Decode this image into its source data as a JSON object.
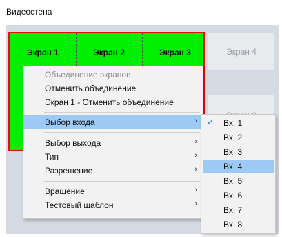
{
  "title": "Видеостена",
  "screens": {
    "s1": "Экран 1",
    "s2": "Экран 2",
    "s3": "Экран 3",
    "s4": "Экран 4",
    "s8": "Экран 8"
  },
  "colors": {
    "merged_fill": "#00ee00",
    "merged_border": "#e01010",
    "highlight": "#9ccaf5"
  },
  "menu": {
    "items": [
      {
        "label": "Объединение экранов",
        "disabled": true
      },
      {
        "label": "Отменить объединение"
      },
      {
        "label": "Экран 1 - Отменить объединение"
      },
      {
        "label": "Выбор входа",
        "submenu": true,
        "highlighted": true
      },
      {
        "label": "Выбор выхода",
        "submenu": true
      },
      {
        "label": "Тип",
        "submenu": true
      },
      {
        "label": "Разрешение",
        "submenu": true
      },
      {
        "label": "Вращение",
        "submenu": true
      },
      {
        "label": "Тестовый шаблон",
        "submenu": true
      }
    ],
    "arrow": "›"
  },
  "submenu": {
    "check": "✓",
    "items": [
      {
        "label": "Вх. 1",
        "checked": true
      },
      {
        "label": "Вх. 2"
      },
      {
        "label": "Вх. 3"
      },
      {
        "label": "Вх. 4",
        "highlighted": true
      },
      {
        "label": "Вх. 5"
      },
      {
        "label": "Вх. 6"
      },
      {
        "label": "Вх. 7"
      },
      {
        "label": "Вх. 8"
      }
    ]
  }
}
